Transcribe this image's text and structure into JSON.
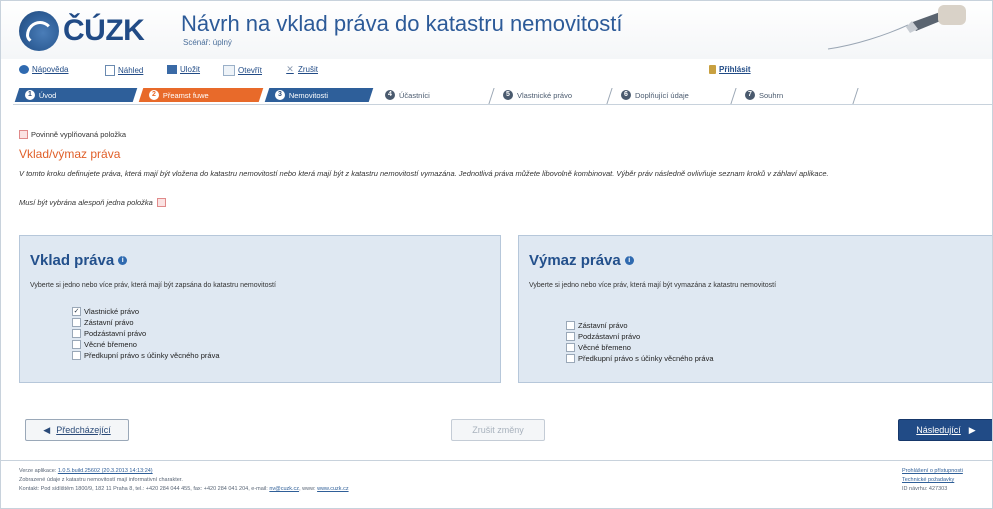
{
  "header": {
    "logo_text": "ČÚZK",
    "title": "Návrh na vklad práva do katastru nemovitostí",
    "subtitle": "Scénář: úplný"
  },
  "toolbar": {
    "help": "Nápověda",
    "preview": "Náhled",
    "save": "Uložit",
    "open": "Otevřít",
    "cancel": "Zrušit",
    "login": "Přihlásit"
  },
  "steps": [
    {
      "num": "1",
      "label": "Úvod",
      "state": "done"
    },
    {
      "num": "2",
      "label": "Přeamst fuwe",
      "state": "current"
    },
    {
      "num": "3",
      "label": "Nemovitosti",
      "state": "next"
    },
    {
      "num": "4",
      "label": "Účastníci",
      "state": "todo"
    },
    {
      "num": "5",
      "label": "Vlastnické právo",
      "state": "todo"
    },
    {
      "num": "6",
      "label": "Doplňující údaje",
      "state": "todo"
    },
    {
      "num": "7",
      "label": "Souhrn",
      "state": "todo"
    }
  ],
  "main": {
    "required_note": "Povinně vyplňovaná položka",
    "section_title": "Vklad/výmaz práva",
    "description": "V tomto kroku definujete práva, která mají být vložena do katastru nemovitostí nebo která mají být z katastru nemovitostí vymazána. Jednotlivá práva můžete libovolně kombinovat. Výběr práv následně ovlivňuje seznam kroků v záhlaví aplikace.",
    "must_select": "Musí být vybrána alespoň jedna položka"
  },
  "vklad": {
    "title": "Vklad práva",
    "desc": "Vyberte si jedno nebo více práv, která mají být zapsána do katastru nemovitostí",
    "items": [
      {
        "label": "Vlastnické právo",
        "mark": "✓"
      },
      {
        "label": "Zástavní právo",
        "mark": ""
      },
      {
        "label": "Podzástavní právo",
        "mark": ""
      },
      {
        "label": "Věcné břemeno",
        "mark": ""
      },
      {
        "label": "Předkupní právo s účinky věcného práva",
        "mark": ""
      }
    ]
  },
  "vymaz": {
    "title": "Výmaz práva",
    "desc": "Vyberte si jedno nebo více práv, která mají být vymazána z katastru nemovitostí",
    "items": [
      {
        "label": "Zástavní právo",
        "mark": ""
      },
      {
        "label": "Podzástavní právo",
        "mark": ""
      },
      {
        "label": "Věcné břemeno",
        "mark": ""
      },
      {
        "label": "Předkupní právo s účinky věcného práva",
        "mark": ""
      }
    ]
  },
  "buttons": {
    "prev": "Předcházející",
    "discard": "Zrušit změny",
    "next": "Následující"
  },
  "footer": {
    "version_label": "Verze aplikace:",
    "version_value": "1.0.5.build.25602 (20.3.2013 14:13:24)",
    "line2": "Zobrazené údaje z katastru nemovitostí mají informativní charakter.",
    "contact": "Kontakt: Pod sídlištěm 1800/9, 182 11 Praha 8, tel.: +420 284 044 455, fax: +420 284 041 204, e-mail:",
    "email": "nv@cuzk.cz",
    "web_label": ", www:",
    "web": "www.cuzk.cz",
    "accessibility": "Prohlášení o přístupnosti",
    "tech_req": "Technické požadavky",
    "id_label": "ID návrhu: 427303"
  },
  "colors": {
    "brand_blue": "#214b86",
    "step_active": "#e86a2a",
    "panel_bg": "#dfe8f2",
    "section_title": "#e0602a"
  }
}
